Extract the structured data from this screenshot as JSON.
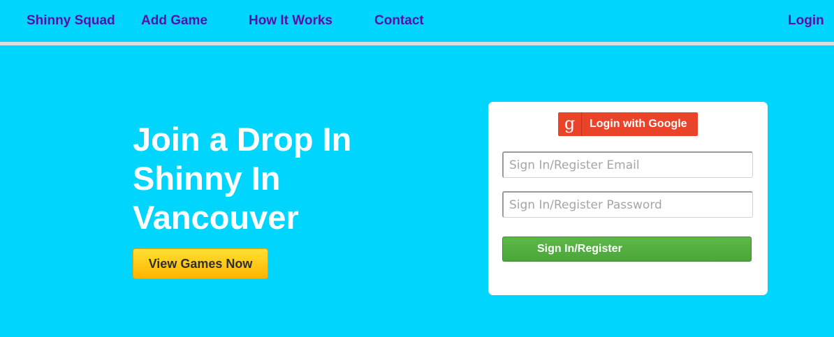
{
  "nav": {
    "brand": "Shinny Squad",
    "add_game": "Add Game",
    "how_it_works": "How It Works",
    "contact": "Contact",
    "login": "Login"
  },
  "hero": {
    "title": "Join a Drop In Shinny In Vancouver",
    "cta_label": "View Games Now"
  },
  "login_card": {
    "google_icon": "g",
    "google_label": "Login with Google",
    "email_placeholder": "Sign In/Register Email",
    "email_value": "",
    "password_placeholder": "Sign In/Register Password",
    "password_value": "",
    "submit_label": "Sign In/Register"
  },
  "colors": {
    "background": "#00d5fe",
    "nav_link": "#5a0fa8",
    "cta_yellow": "#ffc107",
    "google_red": "#e9432a",
    "submit_green": "#52ad3e"
  },
  "icons": {
    "google": "google-icon"
  }
}
